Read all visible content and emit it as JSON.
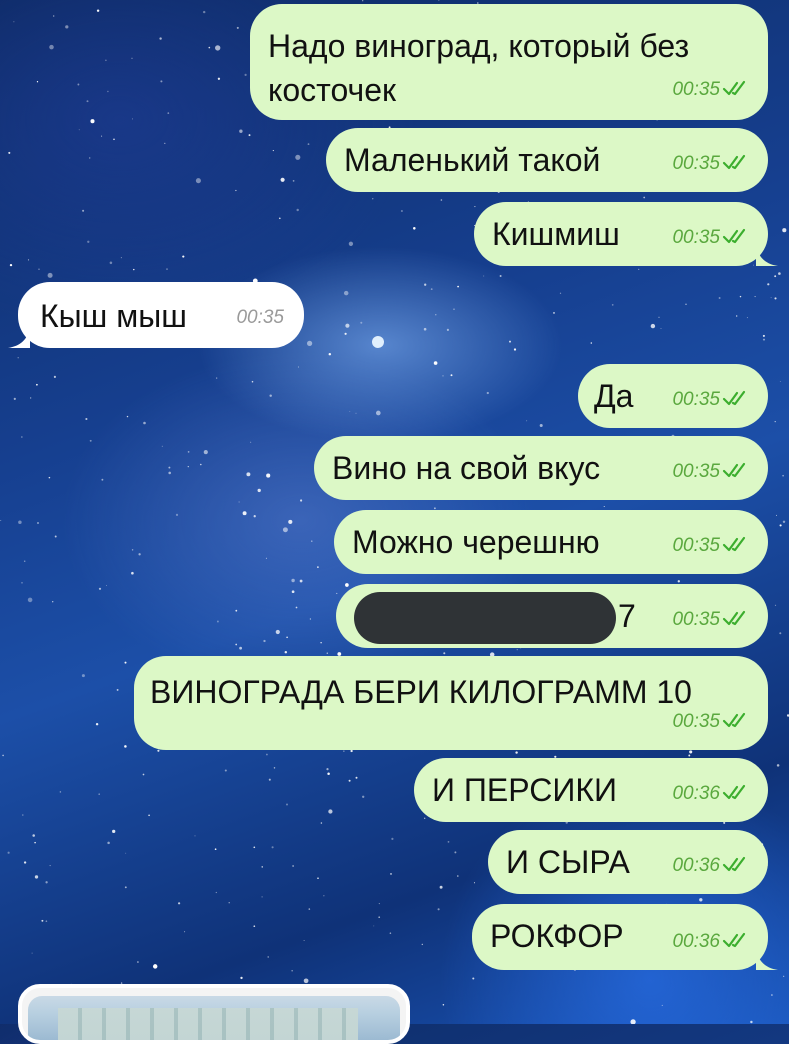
{
  "messages": [
    {
      "dir": "out",
      "lines": [
        "Надо виноград, который без",
        "косточек"
      ],
      "time": "00:35"
    },
    {
      "dir": "out",
      "lines": [
        "Маленький такой"
      ],
      "time": "00:35"
    },
    {
      "dir": "out",
      "lines": [
        "Кишмиш"
      ],
      "time": "00:35"
    },
    {
      "dir": "in",
      "lines": [
        "Кыш мыш"
      ],
      "time": "00:35"
    },
    {
      "dir": "out",
      "lines": [
        "Да"
      ],
      "time": "00:35"
    },
    {
      "dir": "out",
      "lines": [
        "Вино на свой вкус"
      ],
      "time": "00:35"
    },
    {
      "dir": "out",
      "lines": [
        "Можно черешню"
      ],
      "time": "00:35"
    },
    {
      "dir": "out",
      "lines": [
        "7"
      ],
      "time": "00:35",
      "redacted": true
    },
    {
      "dir": "out",
      "lines": [
        "ВИНОГРАДА БЕРИ КИЛОГРАММ 10"
      ],
      "time": "00:35"
    },
    {
      "dir": "out",
      "lines": [
        "И ПЕРСИКИ"
      ],
      "time": "00:36"
    },
    {
      "dir": "out",
      "lines": [
        "И СЫРА"
      ],
      "time": "00:36"
    },
    {
      "dir": "out",
      "lines": [
        "РОКФОР"
      ],
      "time": "00:36"
    }
  ],
  "colors": {
    "outgoing_bubble": "#dcf8c6",
    "incoming_bubble": "#ffffff",
    "time_out": "#5aa83e",
    "time_in": "#9a9a9a",
    "read_ticks": "#3cae2e"
  },
  "icons": {
    "read_status": "double-check-icon",
    "photo": "photo-thumbnail"
  }
}
